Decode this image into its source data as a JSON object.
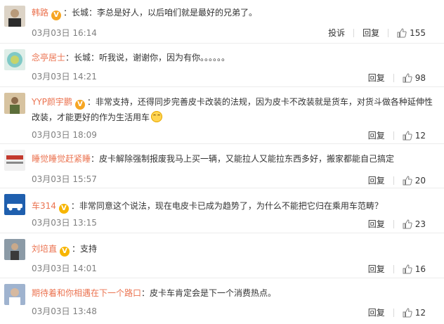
{
  "comments": [
    {
      "user": "韩路",
      "verified": true,
      "badge": "V",
      "text": "长城：李总是好人，以后咱们就是最好的兄弟了。",
      "time": "03月03日 16:14",
      "report": "投诉",
      "reply": "回复",
      "likes": "155",
      "avatar_colors": [
        "#2c2c2c",
        "#b89a7a"
      ]
    },
    {
      "user": "念亭居士",
      "verified": false,
      "text": "长城：听我说，谢谢你，因为有你。。。。。。",
      "time": "03月03日 14:21",
      "reply": "回复",
      "likes": "98",
      "avatar_colors": [
        "#7fc9c6",
        "#c7d46b"
      ]
    },
    {
      "user": "YYP颜宇鹏",
      "verified": true,
      "badge": "V",
      "text": "非常支持，还得同步完善皮卡改装的法规，因为皮卡不改装就是货车，对货斗做各种延伸性改装，才能更好的作为生活用车",
      "emoji": "smile-emoji",
      "time": "03月03日 18:09",
      "reply": "回复",
      "likes": "12",
      "avatar_colors": [
        "#d7c3a0",
        "#5c6e3a"
      ]
    },
    {
      "user": "睡觉睡觉赶紧睡",
      "verified": false,
      "text": "皮卡解除强制报废我马上买一辆，又能拉人又能拉东西多好，搬家都能自己搞定",
      "time": "03月03日 15:57",
      "reply": "回复",
      "likes": "20",
      "avatar_colors": [
        "#f0f0f0",
        "#c33a2e"
      ]
    },
    {
      "user": "车314",
      "verified": true,
      "badge": "V",
      "text": "非常同意这个说法，现在电皮卡已成为趋势了，为什么不能把它归在乘用车范畴？",
      "time": "03月03日 13:15",
      "reply": "回复",
      "likes": "23",
      "avatar_colors": [
        "#1f5fae",
        "#ffffff"
      ]
    },
    {
      "user": "刘培直",
      "verified": true,
      "badge": "V",
      "text": "支持",
      "time": "03月03日 14:01",
      "reply": "回复",
      "likes": "16",
      "avatar_colors": [
        "#8b9aa6",
        "#3a3a3a"
      ]
    },
    {
      "user": "期待着和你相遇在下一个路口",
      "verified": false,
      "text": "皮卡车肯定会是下一个消费热点。",
      "time": "03月03日 13:48",
      "reply": "回复",
      "likes": "12",
      "avatar_colors": [
        "#9fb3cf",
        "#d6b9a0"
      ]
    }
  ]
}
